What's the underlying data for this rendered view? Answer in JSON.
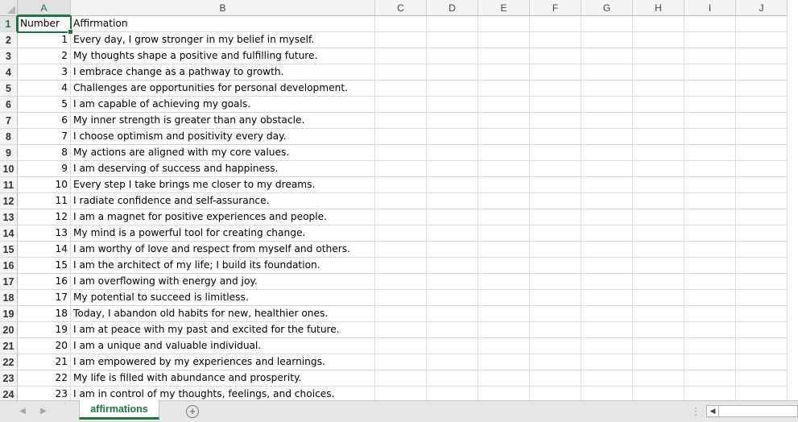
{
  "sheet": {
    "columns": [
      "A",
      "B",
      "C",
      "D",
      "E",
      "F",
      "G",
      "H",
      "I",
      "J"
    ],
    "rows": [
      "1",
      "2",
      "3",
      "4",
      "5",
      "6",
      "7",
      "8",
      "9",
      "10",
      "11",
      "12",
      "13",
      "14",
      "15",
      "16",
      "17",
      "18",
      "19",
      "20",
      "21",
      "22",
      "23",
      "24"
    ],
    "header_row": {
      "number": "Number",
      "affirmation": "Affirmation"
    },
    "data": [
      {
        "n": "1",
        "text": "Every day, I grow stronger in my belief in myself."
      },
      {
        "n": "2",
        "text": "My thoughts shape a positive and fulfilling future."
      },
      {
        "n": "3",
        "text": "I embrace change as a pathway to growth."
      },
      {
        "n": "4",
        "text": "Challenges are opportunities for personal development."
      },
      {
        "n": "5",
        "text": "I am capable of achieving my goals."
      },
      {
        "n": "6",
        "text": "My inner strength is greater than any obstacle."
      },
      {
        "n": "7",
        "text": "I choose optimism and positivity every day."
      },
      {
        "n": "8",
        "text": "My actions are aligned with my core values."
      },
      {
        "n": "9",
        "text": "I am deserving of success and happiness."
      },
      {
        "n": "10",
        "text": "Every step I take brings me closer to my dreams."
      },
      {
        "n": "11",
        "text": "I radiate confidence and self-assurance."
      },
      {
        "n": "12",
        "text": "I am a magnet for positive experiences and people."
      },
      {
        "n": "13",
        "text": "My mind is a powerful tool for creating change."
      },
      {
        "n": "14",
        "text": "I am worthy of love and respect from myself and others."
      },
      {
        "n": "15",
        "text": "I am the architect of my life; I build its foundation."
      },
      {
        "n": "16",
        "text": "I am overflowing with energy and joy."
      },
      {
        "n": "17",
        "text": "My potential to succeed is limitless."
      },
      {
        "n": "18",
        "text": "Today, I abandon old habits for new, healthier ones."
      },
      {
        "n": "19",
        "text": "I am at peace with my past and excited for the future."
      },
      {
        "n": "20",
        "text": "I am a unique and valuable individual."
      },
      {
        "n": "21",
        "text": "I am empowered by my experiences and learnings."
      },
      {
        "n": "22",
        "text": "My life is filled with abundance and prosperity."
      },
      {
        "n": "23",
        "text": "I am in control of my thoughts, feelings, and choices."
      }
    ],
    "selected_cell": "A1"
  },
  "tabs": {
    "active_sheet": "affirmations",
    "add_sheet_symbol": "+",
    "split_symbol": "⋮"
  },
  "colors": {
    "accent": "#217346",
    "header_bg": "#f3f3f3",
    "grid_line": "#dadada"
  },
  "icons": {
    "nav_prev": "triangle-left-icon",
    "nav_next": "triangle-right-icon",
    "add": "plus-circle-icon",
    "scroll_left": "scroll-left-arrow-icon"
  }
}
